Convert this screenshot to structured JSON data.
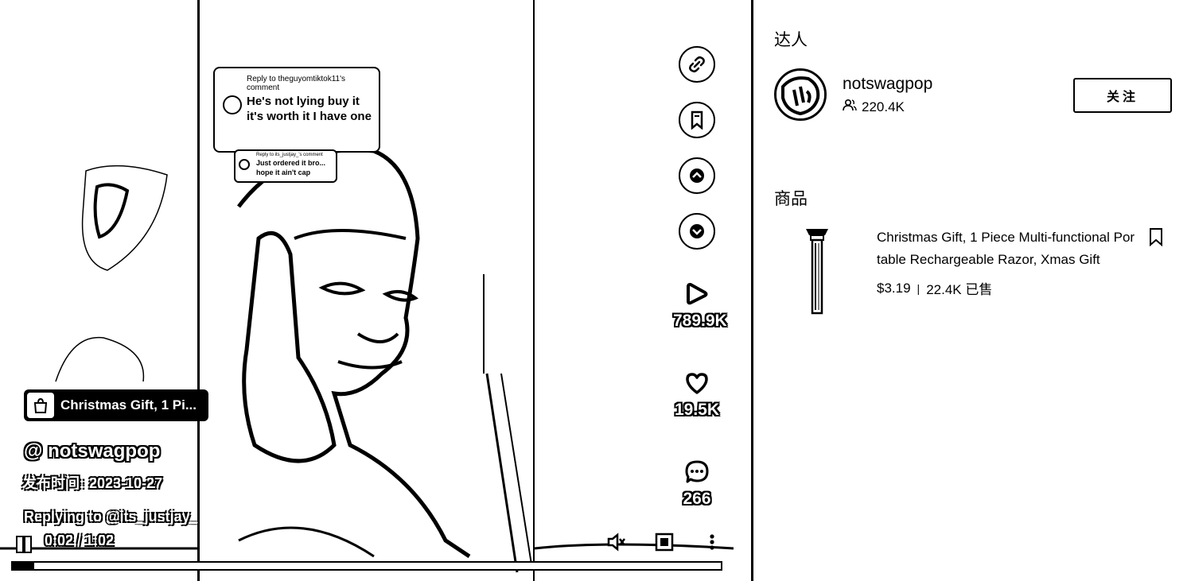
{
  "video": {
    "comment_card": {
      "reply_to": "Reply to theguyomtiktok11's comment",
      "text": "He's not lying buy it it's worth it I have one"
    },
    "comment_card_small": {
      "reply_to": "Reply to its_justjay_'s comment",
      "text": "Just ordered it bro... hope it ain't cap"
    },
    "product_chip": {
      "text": "Christmas Gift, 1 Pi..."
    },
    "author": "@ notswagpop",
    "publish_label": "发布时间:",
    "publish_date": "2023-10-27",
    "caption": "Replying to @its_justjay_",
    "time_display": "0:02 / 1:02",
    "progress": 0.03,
    "actions": {
      "link_icon": "link-icon",
      "bookmark_icon": "bookmark-icon",
      "up_icon": "chevron-up-icon",
      "down_icon": "chevron-down-icon",
      "plays": "789.9K",
      "likes": "19.5K",
      "comments": "266"
    }
  },
  "panel": {
    "creator_section_title": "达人",
    "creator_name": "notswagpop",
    "followers": "220.4K",
    "follow_label": "关注",
    "products_section_title": "商品",
    "product": {
      "title": "Christmas Gift, 1 Piece Multi-functional Portable Rechargeable Razor, Xmas Gift",
      "price": "$3.19",
      "sold": "22.4K 已售"
    }
  }
}
